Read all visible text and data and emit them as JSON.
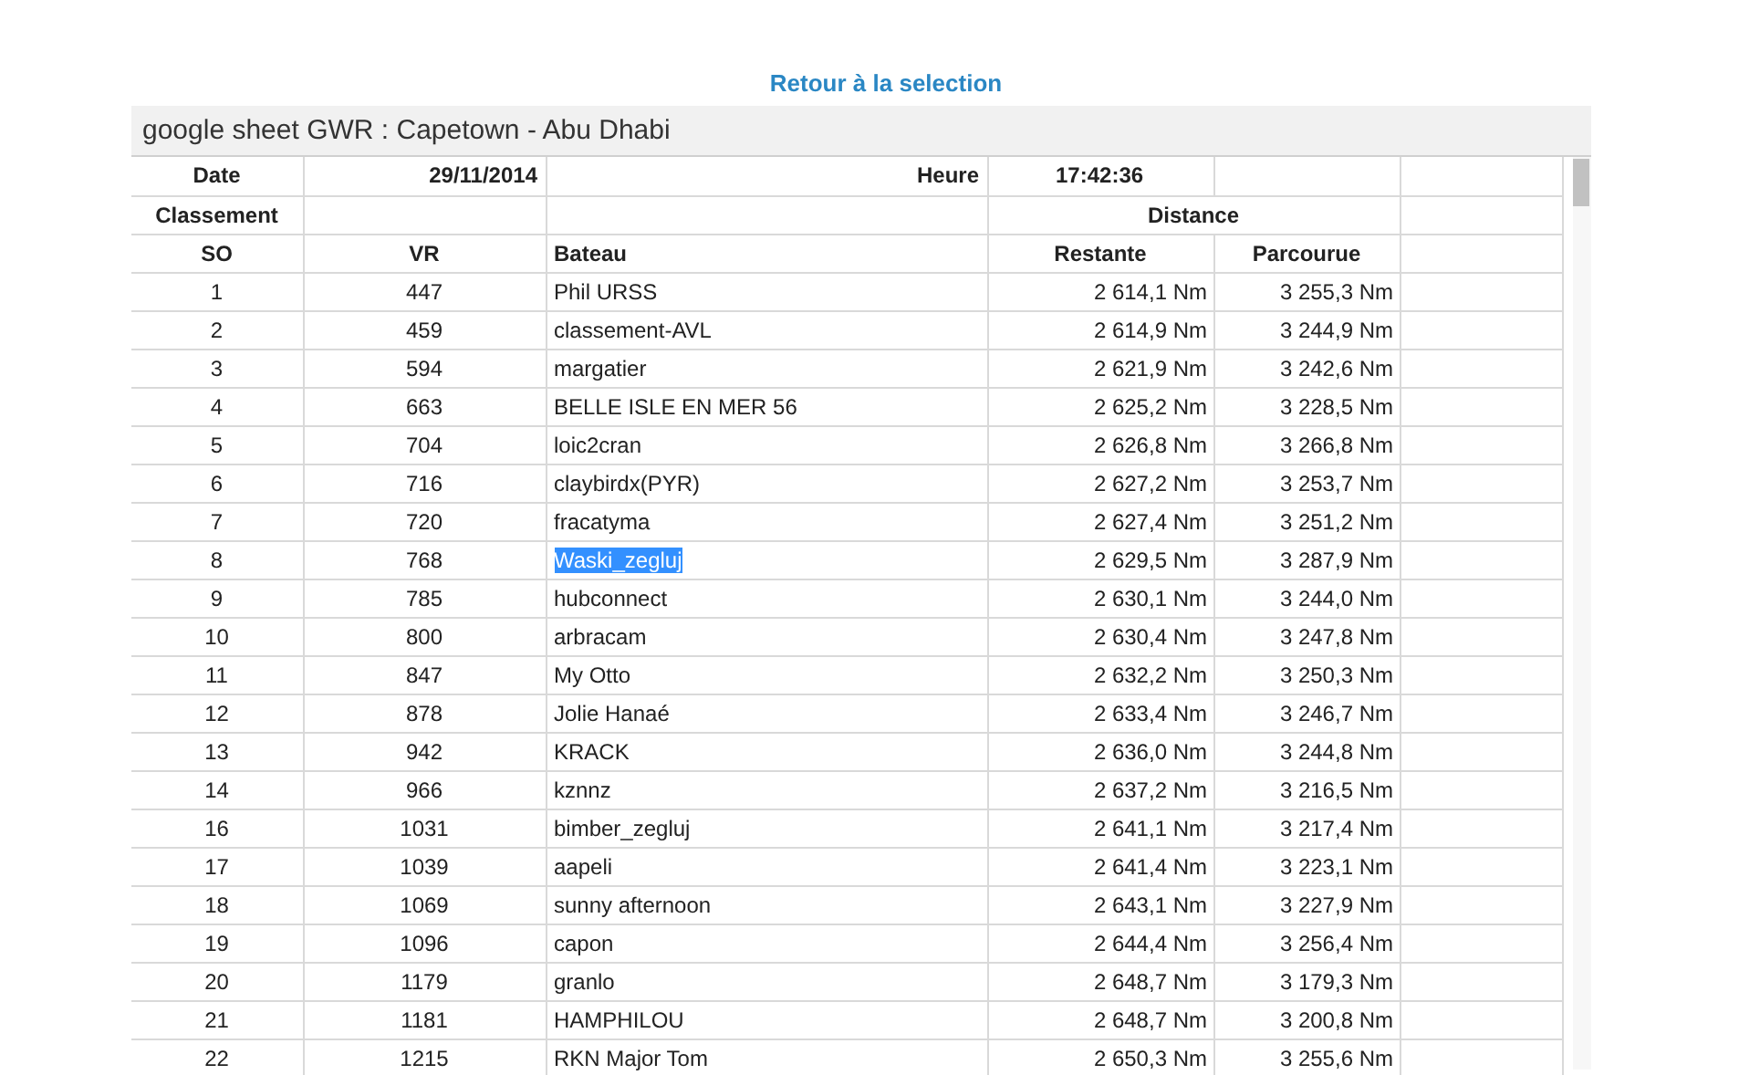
{
  "link": "Retour à la selection",
  "sheet": {
    "title": "google sheet GWR : Capetown - Abu Dhabi",
    "info": {
      "date_label": "Date",
      "date": "29/11/2014",
      "time_label": "Heure",
      "time": "17:42:36",
      "rank_label": "Classement",
      "distance_label": "Distance"
    },
    "columns": [
      "SO",
      "VR",
      "Bateau",
      "Restante",
      "Parcourue"
    ],
    "rows": [
      {
        "so": "1",
        "vr": "447",
        "bateau": "Phil URSS",
        "restante": "2 614,1 Nm",
        "parcourue": "3 255,3 Nm",
        "selected": false
      },
      {
        "so": "2",
        "vr": "459",
        "bateau": "classement-AVL",
        "restante": "2 614,9 Nm",
        "parcourue": "3 244,9 Nm",
        "selected": false
      },
      {
        "so": "3",
        "vr": "594",
        "bateau": "margatier",
        "restante": "2 621,9 Nm",
        "parcourue": "3 242,6 Nm",
        "selected": false
      },
      {
        "so": "4",
        "vr": "663",
        "bateau": "BELLE ISLE EN MER 56",
        "restante": "2 625,2 Nm",
        "parcourue": "3 228,5 Nm",
        "selected": false
      },
      {
        "so": "5",
        "vr": "704",
        "bateau": "loic2cran",
        "restante": "2 626,8 Nm",
        "parcourue": "3 266,8 Nm",
        "selected": false
      },
      {
        "so": "6",
        "vr": "716",
        "bateau": "claybirdx(PYR)",
        "restante": "2 627,2 Nm",
        "parcourue": "3 253,7 Nm",
        "selected": false
      },
      {
        "so": "7",
        "vr": "720",
        "bateau": "fracatyma",
        "restante": "2 627,4 Nm",
        "parcourue": "3 251,2 Nm",
        "selected": false
      },
      {
        "so": "8",
        "vr": "768",
        "bateau": "Waski_zegluj",
        "restante": "2 629,5 Nm",
        "parcourue": "3 287,9 Nm",
        "selected": true
      },
      {
        "so": "9",
        "vr": "785",
        "bateau": "hubconnect",
        "restante": "2 630,1 Nm",
        "parcourue": "3 244,0 Nm",
        "selected": false
      },
      {
        "so": "10",
        "vr": "800",
        "bateau": "arbracam",
        "restante": "2 630,4 Nm",
        "parcourue": "3 247,8 Nm",
        "selected": false
      },
      {
        "so": "11",
        "vr": "847",
        "bateau": "My Otto",
        "restante": "2 632,2 Nm",
        "parcourue": "3 250,3 Nm",
        "selected": false
      },
      {
        "so": "12",
        "vr": "878",
        "bateau": "Jolie Hanaé",
        "restante": "2 633,4 Nm",
        "parcourue": "3 246,7 Nm",
        "selected": false
      },
      {
        "so": "13",
        "vr": "942",
        "bateau": "KRACK",
        "restante": "2 636,0 Nm",
        "parcourue": "3 244,8 Nm",
        "selected": false
      },
      {
        "so": "14",
        "vr": "966",
        "bateau": "kznnz",
        "restante": "2 637,2 Nm",
        "parcourue": "3 216,5 Nm",
        "selected": false
      },
      {
        "so": "16",
        "vr": "1031",
        "bateau": "bimber_zegluj",
        "restante": "2 641,1 Nm",
        "parcourue": "3 217,4 Nm",
        "selected": false
      },
      {
        "so": "17",
        "vr": "1039",
        "bateau": "aapeli",
        "restante": "2 641,4 Nm",
        "parcourue": "3 223,1 Nm",
        "selected": false
      },
      {
        "so": "18",
        "vr": "1069",
        "bateau": "sunny afternoon",
        "restante": "2 643,1 Nm",
        "parcourue": "3 227,9 Nm",
        "selected": false
      },
      {
        "so": "19",
        "vr": "1096",
        "bateau": "capon",
        "restante": "2 644,4 Nm",
        "parcourue": "3 256,4 Nm",
        "selected": false
      },
      {
        "so": "20",
        "vr": "1179",
        "bateau": "granlo",
        "restante": "2 648,7 Nm",
        "parcourue": "3 179,3 Nm",
        "selected": false
      },
      {
        "so": "21",
        "vr": "1181",
        "bateau": "HAMPHILOU",
        "restante": "2 648,7 Nm",
        "parcourue": "3 200,8 Nm",
        "selected": false
      },
      {
        "so": "22",
        "vr": "1215",
        "bateau": "RKN Major Tom",
        "restante": "2 650,3 Nm",
        "parcourue": "3 255,6 Nm",
        "selected": false
      }
    ]
  }
}
